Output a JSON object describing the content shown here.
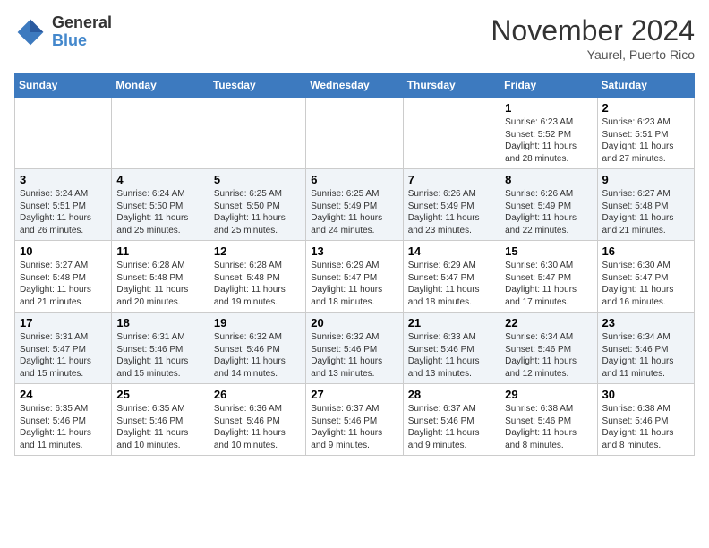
{
  "header": {
    "logo_line1": "General",
    "logo_line2": "Blue",
    "month": "November 2024",
    "location": "Yaurel, Puerto Rico"
  },
  "weekdays": [
    "Sunday",
    "Monday",
    "Tuesday",
    "Wednesday",
    "Thursday",
    "Friday",
    "Saturday"
  ],
  "weeks": [
    [
      {
        "day": "",
        "info": ""
      },
      {
        "day": "",
        "info": ""
      },
      {
        "day": "",
        "info": ""
      },
      {
        "day": "",
        "info": ""
      },
      {
        "day": "",
        "info": ""
      },
      {
        "day": "1",
        "info": "Sunrise: 6:23 AM\nSunset: 5:52 PM\nDaylight: 11 hours and 28 minutes."
      },
      {
        "day": "2",
        "info": "Sunrise: 6:23 AM\nSunset: 5:51 PM\nDaylight: 11 hours and 27 minutes."
      }
    ],
    [
      {
        "day": "3",
        "info": "Sunrise: 6:24 AM\nSunset: 5:51 PM\nDaylight: 11 hours and 26 minutes."
      },
      {
        "day": "4",
        "info": "Sunrise: 6:24 AM\nSunset: 5:50 PM\nDaylight: 11 hours and 25 minutes."
      },
      {
        "day": "5",
        "info": "Sunrise: 6:25 AM\nSunset: 5:50 PM\nDaylight: 11 hours and 25 minutes."
      },
      {
        "day": "6",
        "info": "Sunrise: 6:25 AM\nSunset: 5:49 PM\nDaylight: 11 hours and 24 minutes."
      },
      {
        "day": "7",
        "info": "Sunrise: 6:26 AM\nSunset: 5:49 PM\nDaylight: 11 hours and 23 minutes."
      },
      {
        "day": "8",
        "info": "Sunrise: 6:26 AM\nSunset: 5:49 PM\nDaylight: 11 hours and 22 minutes."
      },
      {
        "day": "9",
        "info": "Sunrise: 6:27 AM\nSunset: 5:48 PM\nDaylight: 11 hours and 21 minutes."
      }
    ],
    [
      {
        "day": "10",
        "info": "Sunrise: 6:27 AM\nSunset: 5:48 PM\nDaylight: 11 hours and 21 minutes."
      },
      {
        "day": "11",
        "info": "Sunrise: 6:28 AM\nSunset: 5:48 PM\nDaylight: 11 hours and 20 minutes."
      },
      {
        "day": "12",
        "info": "Sunrise: 6:28 AM\nSunset: 5:48 PM\nDaylight: 11 hours and 19 minutes."
      },
      {
        "day": "13",
        "info": "Sunrise: 6:29 AM\nSunset: 5:47 PM\nDaylight: 11 hours and 18 minutes."
      },
      {
        "day": "14",
        "info": "Sunrise: 6:29 AM\nSunset: 5:47 PM\nDaylight: 11 hours and 18 minutes."
      },
      {
        "day": "15",
        "info": "Sunrise: 6:30 AM\nSunset: 5:47 PM\nDaylight: 11 hours and 17 minutes."
      },
      {
        "day": "16",
        "info": "Sunrise: 6:30 AM\nSunset: 5:47 PM\nDaylight: 11 hours and 16 minutes."
      }
    ],
    [
      {
        "day": "17",
        "info": "Sunrise: 6:31 AM\nSunset: 5:47 PM\nDaylight: 11 hours and 15 minutes."
      },
      {
        "day": "18",
        "info": "Sunrise: 6:31 AM\nSunset: 5:46 PM\nDaylight: 11 hours and 15 minutes."
      },
      {
        "day": "19",
        "info": "Sunrise: 6:32 AM\nSunset: 5:46 PM\nDaylight: 11 hours and 14 minutes."
      },
      {
        "day": "20",
        "info": "Sunrise: 6:32 AM\nSunset: 5:46 PM\nDaylight: 11 hours and 13 minutes."
      },
      {
        "day": "21",
        "info": "Sunrise: 6:33 AM\nSunset: 5:46 PM\nDaylight: 11 hours and 13 minutes."
      },
      {
        "day": "22",
        "info": "Sunrise: 6:34 AM\nSunset: 5:46 PM\nDaylight: 11 hours and 12 minutes."
      },
      {
        "day": "23",
        "info": "Sunrise: 6:34 AM\nSunset: 5:46 PM\nDaylight: 11 hours and 11 minutes."
      }
    ],
    [
      {
        "day": "24",
        "info": "Sunrise: 6:35 AM\nSunset: 5:46 PM\nDaylight: 11 hours and 11 minutes."
      },
      {
        "day": "25",
        "info": "Sunrise: 6:35 AM\nSunset: 5:46 PM\nDaylight: 11 hours and 10 minutes."
      },
      {
        "day": "26",
        "info": "Sunrise: 6:36 AM\nSunset: 5:46 PM\nDaylight: 11 hours and 10 minutes."
      },
      {
        "day": "27",
        "info": "Sunrise: 6:37 AM\nSunset: 5:46 PM\nDaylight: 11 hours and 9 minutes."
      },
      {
        "day": "28",
        "info": "Sunrise: 6:37 AM\nSunset: 5:46 PM\nDaylight: 11 hours and 9 minutes."
      },
      {
        "day": "29",
        "info": "Sunrise: 6:38 AM\nSunset: 5:46 PM\nDaylight: 11 hours and 8 minutes."
      },
      {
        "day": "30",
        "info": "Sunrise: 6:38 AM\nSunset: 5:46 PM\nDaylight: 11 hours and 8 minutes."
      }
    ]
  ]
}
